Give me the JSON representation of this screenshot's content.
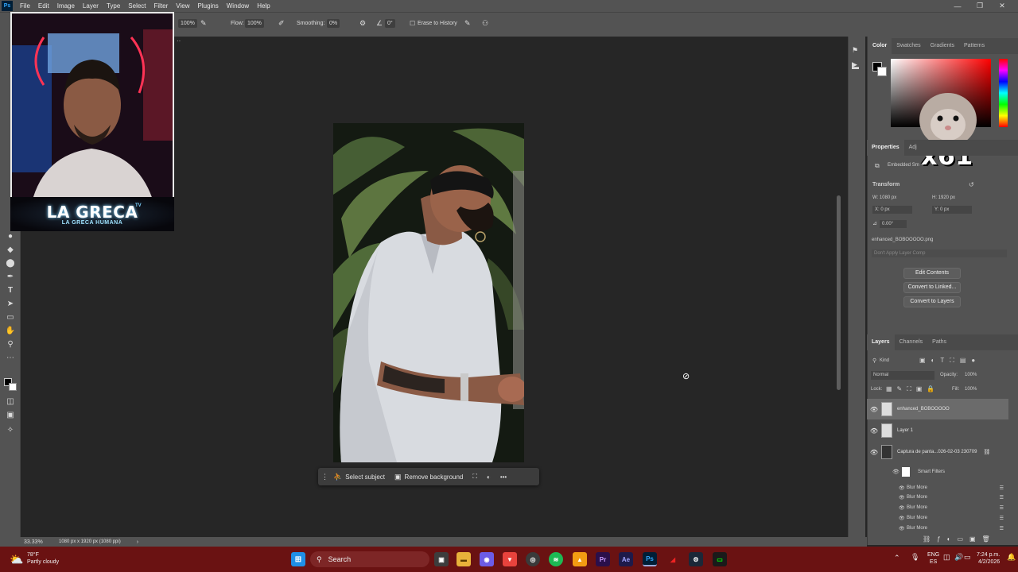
{
  "menu": {
    "logo": "Ps",
    "items": [
      "File",
      "Edit",
      "Image",
      "Layer",
      "Type",
      "Select",
      "Filter",
      "View",
      "Plugins",
      "Window",
      "Help"
    ]
  },
  "options_bar": {
    "size": "100%",
    "flow_label": "Flow:",
    "flow_value": "100%",
    "smoothing_label": "Smoothing:",
    "smoothing_value": "0%",
    "angle_value": "0°",
    "erase_label": "Erase to History"
  },
  "webcam": {
    "banner_title": "LA GRECA",
    "banner_sub": "LA GRECA HUMANA",
    "badge": "TV"
  },
  "context_bar": {
    "select_subject": "Select subject",
    "remove_background": "Remove background",
    "more": "•••"
  },
  "status": {
    "zoom": "33.33%",
    "doc_info": "1080 px x 1920 px (1080 ppi)"
  },
  "color_panel": {
    "tabs": [
      "Color",
      "Swatches",
      "Gradients",
      "Patterns"
    ]
  },
  "sticker_text": "x61",
  "properties": {
    "tab": "Properties",
    "tab2": "Adj",
    "type_label": "Embedded Sm",
    "transform_label": "Transform",
    "w": "W: 1080 px",
    "h": "H: 1920 px",
    "x": "X: 0 px",
    "y": "Y: 0 px",
    "angle": "0.00°",
    "filename": "enhanced_BOBOOOOO.png",
    "comp_placeholder": "Don't Apply Layer Comp",
    "edit_contents": "Edit Contents",
    "convert_linked": "Convert to Linked...",
    "convert_layers": "Convert to Layers"
  },
  "layers_panel": {
    "tabs": [
      "Layers",
      "Channels",
      "Paths"
    ],
    "kind": "Kind",
    "blend_mode": "Normal",
    "opacity_label": "Opacity:",
    "opacity": "100%",
    "lock_label": "Lock:",
    "fill_label": "Fill:",
    "fill": "100%",
    "layers": [
      {
        "name": "enhanced_BOBOOOOO",
        "selected": true
      },
      {
        "name": "Layer 1",
        "selected": false
      },
      {
        "name": "Captura de panta...026-02-03 230709",
        "selected": false
      }
    ],
    "smart_filters": "Smart Filters",
    "filters": [
      "Blur More",
      "Blur More",
      "Blur More",
      "Blur More",
      "Blur More"
    ]
  },
  "taskbar": {
    "weather_temp": "78°F",
    "weather_desc": "Partly cloudy",
    "search_placeholder": "Search",
    "lang1": "ENG",
    "lang2": "ES",
    "time": "7:24 p.m.",
    "date": "4/2/2026"
  }
}
